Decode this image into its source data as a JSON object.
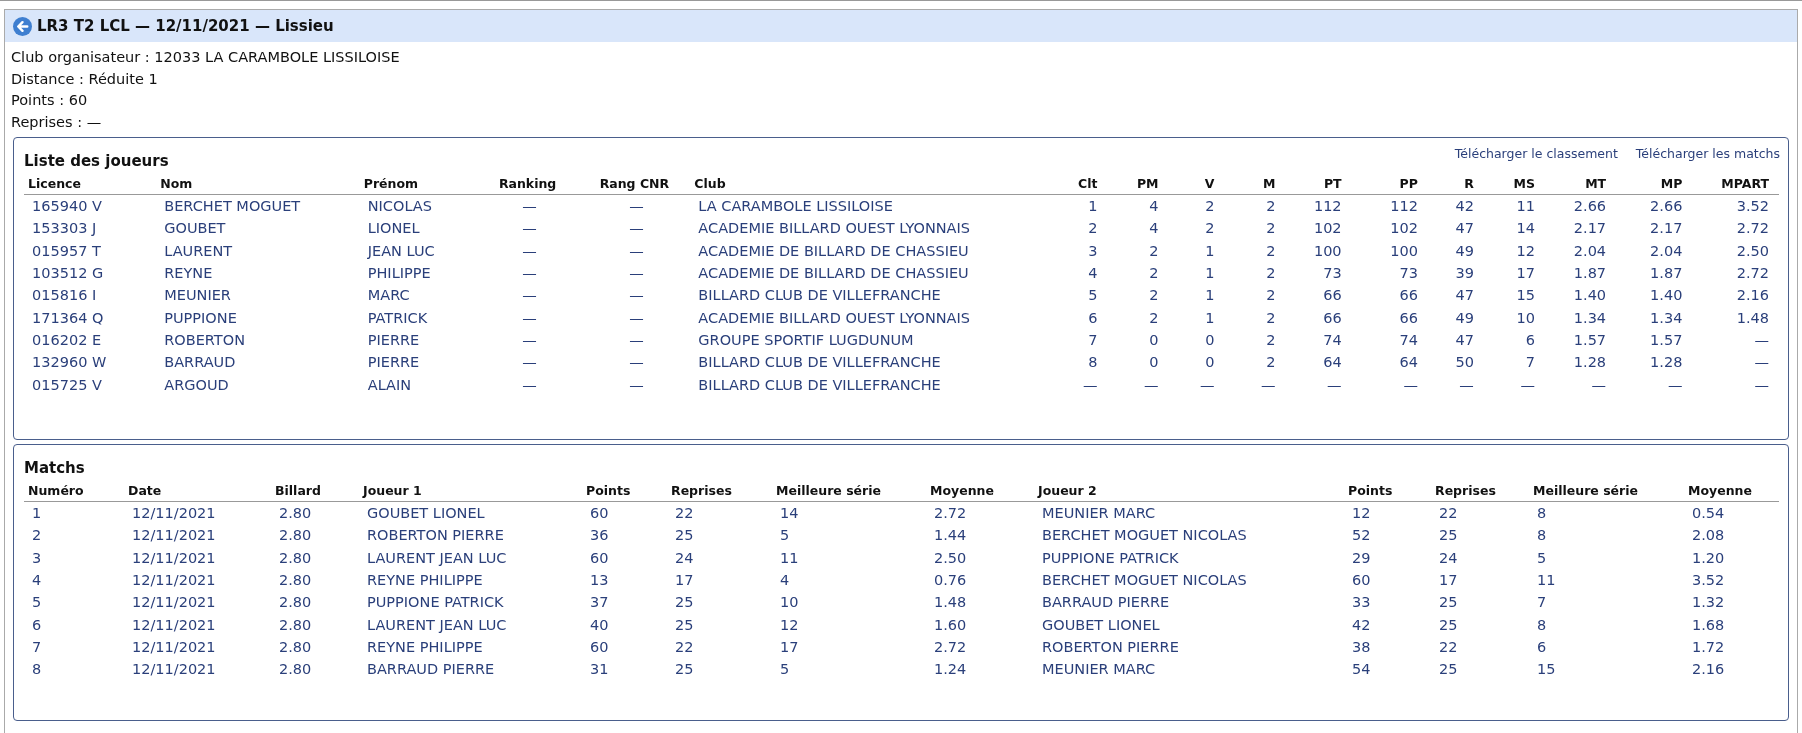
{
  "header": {
    "title": "LR3 T2 LCL — 12/11/2021 — Lissieu"
  },
  "info": [
    "Club organisateur : 12033 LA CARAMBOLE LISSILOISE",
    "Distance : Réduite 1",
    "Points : 60",
    "Reprises : —"
  ],
  "players": {
    "title": "Liste des joueurs",
    "links": [
      "Télécharger le classement",
      "Télécharger les matchs"
    ],
    "columns": [
      "Licence",
      "Nom",
      "Prénom",
      "Ranking",
      "Rang CNR",
      "Club",
      "Clt",
      "PM",
      "V",
      "M",
      "PT",
      "PP",
      "R",
      "MS",
      "MT",
      "MP",
      "MPART"
    ],
    "rows": [
      [
        "165940 V",
        "BERCHET MOGUET",
        "NICOLAS",
        "—",
        "—",
        "LA CARAMBOLE LISSILOISE",
        "1",
        "4",
        "2",
        "2",
        "112",
        "112",
        "42",
        "11",
        "2.66",
        "2.66",
        "3.52"
      ],
      [
        "153303 J",
        "GOUBET",
        "LIONEL",
        "—",
        "—",
        "ACADEMIE BILLARD OUEST LYONNAIS",
        "2",
        "4",
        "2",
        "2",
        "102",
        "102",
        "47",
        "14",
        "2.17",
        "2.17",
        "2.72"
      ],
      [
        "015957 T",
        "LAURENT",
        "JEAN LUC",
        "—",
        "—",
        "ACADEMIE DE BILLARD DE CHASSIEU",
        "3",
        "2",
        "1",
        "2",
        "100",
        "100",
        "49",
        "12",
        "2.04",
        "2.04",
        "2.50"
      ],
      [
        "103512 G",
        "REYNE",
        "PHILIPPE",
        "—",
        "—",
        "ACADEMIE DE BILLARD DE CHASSIEU",
        "4",
        "2",
        "1",
        "2",
        "73",
        "73",
        "39",
        "17",
        "1.87",
        "1.87",
        "2.72"
      ],
      [
        "015816 I",
        "MEUNIER",
        "MARC",
        "—",
        "—",
        "BILLARD CLUB DE VILLEFRANCHE",
        "5",
        "2",
        "1",
        "2",
        "66",
        "66",
        "47",
        "15",
        "1.40",
        "1.40",
        "2.16"
      ],
      [
        "171364 Q",
        "PUPPIONE",
        "PATRICK",
        "—",
        "—",
        "ACADEMIE BILLARD OUEST LYONNAIS",
        "6",
        "2",
        "1",
        "2",
        "66",
        "66",
        "49",
        "10",
        "1.34",
        "1.34",
        "1.48"
      ],
      [
        "016202 E",
        "ROBERTON",
        "PIERRE",
        "—",
        "—",
        "GROUPE SPORTIF LUGDUNUM",
        "7",
        "0",
        "0",
        "2",
        "74",
        "74",
        "47",
        "6",
        "1.57",
        "1.57",
        "—"
      ],
      [
        "132960 W",
        "BARRAUD",
        "PIERRE",
        "—",
        "—",
        "BILLARD CLUB DE VILLEFRANCHE",
        "8",
        "0",
        "0",
        "2",
        "64",
        "64",
        "50",
        "7",
        "1.28",
        "1.28",
        "—"
      ],
      [
        "015725 V",
        "ARGOUD",
        "ALAIN",
        "—",
        "—",
        "BILLARD CLUB DE VILLEFRANCHE",
        "—",
        "—",
        "—",
        "—",
        "—",
        "—",
        "—",
        "—",
        "—",
        "—",
        "—"
      ]
    ]
  },
  "matches": {
    "title": "Matchs",
    "columns": [
      "Numéro",
      "Date",
      "Billard",
      "Joueur 1",
      "Points",
      "Reprises",
      "Meilleure série",
      "Moyenne",
      "Joueur 2",
      "Points",
      "Reprises",
      "Meilleure série",
      "Moyenne"
    ],
    "rows": [
      [
        "1",
        "12/11/2021",
        "2.80",
        "GOUBET LIONEL",
        "60",
        "22",
        "14",
        "2.72",
        "MEUNIER MARC",
        "12",
        "22",
        "8",
        "0.54"
      ],
      [
        "2",
        "12/11/2021",
        "2.80",
        "ROBERTON PIERRE",
        "36",
        "25",
        "5",
        "1.44",
        "BERCHET MOGUET NICOLAS",
        "52",
        "25",
        "8",
        "2.08"
      ],
      [
        "3",
        "12/11/2021",
        "2.80",
        "LAURENT JEAN LUC",
        "60",
        "24",
        "11",
        "2.50",
        "PUPPIONE PATRICK",
        "29",
        "24",
        "5",
        "1.20"
      ],
      [
        "4",
        "12/11/2021",
        "2.80",
        "REYNE PHILIPPE",
        "13",
        "17",
        "4",
        "0.76",
        "BERCHET MOGUET NICOLAS",
        "60",
        "17",
        "11",
        "3.52"
      ],
      [
        "5",
        "12/11/2021",
        "2.80",
        "PUPPIONE PATRICK",
        "37",
        "25",
        "10",
        "1.48",
        "BARRAUD PIERRE",
        "33",
        "25",
        "7",
        "1.32"
      ],
      [
        "6",
        "12/11/2021",
        "2.80",
        "LAURENT JEAN LUC",
        "40",
        "25",
        "12",
        "1.60",
        "GOUBET LIONEL",
        "42",
        "25",
        "8",
        "1.68"
      ],
      [
        "7",
        "12/11/2021",
        "2.80",
        "REYNE PHILIPPE",
        "60",
        "22",
        "17",
        "2.72",
        "ROBERTON PIERRE",
        "38",
        "22",
        "6",
        "1.72"
      ],
      [
        "8",
        "12/11/2021",
        "2.80",
        "BARRAUD PIERRE",
        "31",
        "25",
        "5",
        "1.24",
        "MEUNIER MARC",
        "54",
        "25",
        "15",
        "2.16"
      ]
    ]
  }
}
